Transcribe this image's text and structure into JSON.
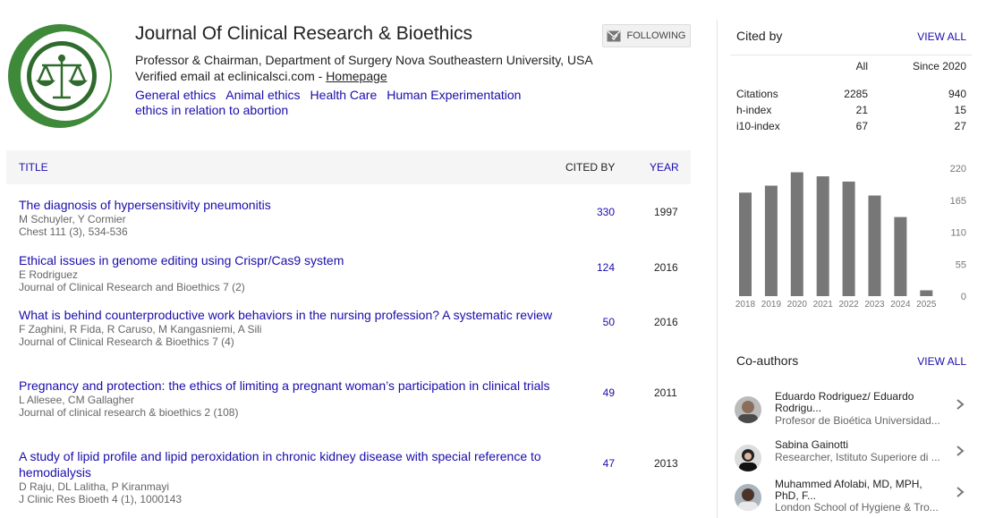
{
  "profile": {
    "name": "Journal Of Clinical Research & Bioethics",
    "affiliation": "Professor & Chairman, Department of Surgery Nova Southeastern University, USA",
    "email_text": "Verified email at eclinicalsci.com - ",
    "homepage_label": "Homepage",
    "interests": [
      "General ethics",
      "Animal ethics",
      "Health Care",
      "Human Experimentation",
      "ethics in relation to abortion"
    ],
    "follow_label": "FOLLOWING"
  },
  "table": {
    "headers": {
      "title": "TITLE",
      "cited_by": "CITED BY",
      "year": "YEAR"
    },
    "rows": [
      {
        "title": "The diagnosis of hypersensitivity pneumonitis",
        "authors": "M Schuyler, Y Cormier",
        "journal": "Chest 111 (3), 534-536",
        "cited": "330",
        "year": "1997"
      },
      {
        "title": "Ethical issues in genome editing using Crispr/Cas9 system",
        "authors": "E Rodriguez",
        "journal": "Journal of Clinical Research and Bioethics 7 (2)",
        "cited": "124",
        "year": "2016"
      },
      {
        "title": "What is behind counterproductive work behaviors in the nursing profession? A systematic review",
        "authors": "F Zaghini, R Fida, R Caruso, M Kangasniemi, A Sili",
        "journal": "Journal of Clinical Research & Bioethics 7 (4)",
        "cited": "50",
        "year": "2016"
      },
      {
        "title": "Pregnancy and protection: the ethics of limiting a pregnant woman’s participation in clinical trials",
        "authors": "L Allesee, CM Gallagher",
        "journal": "Journal of clinical research & bioethics 2 (108)",
        "cited": "49",
        "year": "2011"
      },
      {
        "title": "A study of lipid profile and lipid peroxidation in chronic kidney disease with special reference to hemodialysis",
        "authors": "D Raju, DL Lalitha, P Kiranmayi",
        "journal": "J Clinic Res Bioeth 4 (1), 1000143",
        "cited": "47",
        "year": "2013"
      }
    ]
  },
  "cited_by": {
    "title": "Cited by",
    "view_all": "VIEW ALL",
    "col_all": "All",
    "col_since": "Since 2020",
    "stats": [
      {
        "label": "Citations",
        "all": "2285",
        "since": "940"
      },
      {
        "label": "h-index",
        "all": "21",
        "since": "15"
      },
      {
        "label": "i10-index",
        "all": "67",
        "since": "27"
      }
    ]
  },
  "chart_data": {
    "type": "bar",
    "categories": [
      "2018",
      "2019",
      "2020",
      "2021",
      "2022",
      "2023",
      "2024",
      "2025"
    ],
    "values": [
      178,
      190,
      213,
      206,
      197,
      173,
      136,
      10
    ],
    "y_ticks": [
      "220",
      "165",
      "110",
      "55",
      "0"
    ],
    "ylim": [
      0,
      220
    ],
    "bar_color": "#777777"
  },
  "coauthors": {
    "title": "Co-authors",
    "view_all": "VIEW ALL",
    "items": [
      {
        "name": "Eduardo Rodriguez/ Eduardo Rodrigu...",
        "affiliation": "Profesor de Bioética Universidad..."
      },
      {
        "name": "Sabina Gainotti",
        "affiliation": "Researcher, Istituto Superiore di ..."
      },
      {
        "name": "Muhammed Afolabi, MD, MPH, PhD, F...",
        "affiliation": "London School of Hygiene & Tro..."
      }
    ]
  },
  "colors": {
    "link": "#1a0dab",
    "logo_green": "#3f8a3a"
  }
}
